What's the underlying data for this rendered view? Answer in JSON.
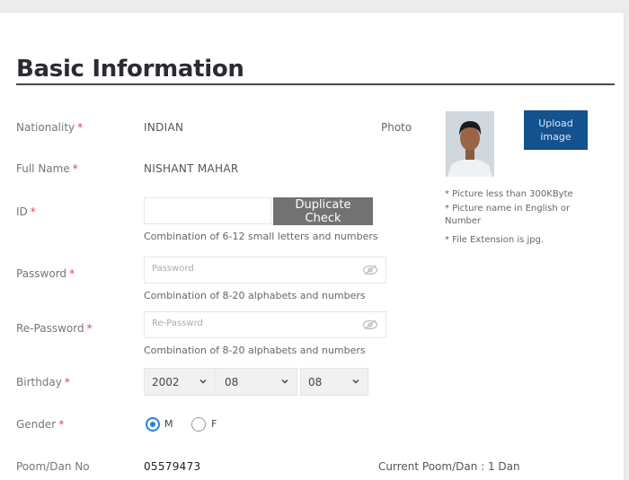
{
  "section": {
    "title": "Basic Information"
  },
  "fields": {
    "nationality": {
      "label": "Nationality",
      "value": "INDIAN"
    },
    "full_name": {
      "label": "Full Name",
      "value": "NISHANT MAHAR"
    },
    "id": {
      "label": "ID",
      "value": "",
      "button": "Duplicate Check",
      "hint": "Combination of 6-12 small letters and numbers"
    },
    "password": {
      "label": "Password",
      "placeholder": "Password",
      "hint": "Combination of 8-20 alphabets and numbers"
    },
    "re_password": {
      "label": "Re-Password",
      "placeholder": "Re-Passwrd",
      "hint": "Combination of 8-20 alphabets and numbers"
    },
    "birthday": {
      "label": "Birthday",
      "year": "2002",
      "month": "08",
      "day": "08"
    },
    "gender": {
      "label": "Gender",
      "options": [
        "M",
        "F"
      ],
      "selected": "M"
    },
    "poom": {
      "label": "Poom/Dan No",
      "value": "05579473",
      "current": "Current Poom/Dan : 1 Dan"
    }
  },
  "required_mark": "*",
  "photo": {
    "label": "Photo",
    "upload_button": "Upload image",
    "notes": [
      "* Picture less than 300KByte",
      "* Picture name in English or Number",
      "* File Extension is jpg."
    ]
  },
  "colors": {
    "accent": "#13518f",
    "required": "#d9464b",
    "radio": "#2a7fd8",
    "button_gray": "#727272"
  }
}
